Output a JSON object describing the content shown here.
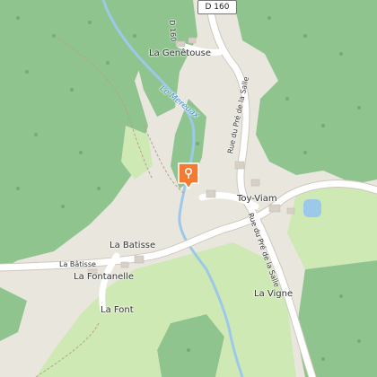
{
  "map": {
    "route_shield": "D 160",
    "road_labels": {
      "top_vertical": "D 160",
      "rue_upper": "Rue du Pré de la Salle",
      "rue_lower": "Rue du Pré de la Salle",
      "batisse_road": "La Bâtisse"
    },
    "places": {
      "genetouse": "La Genêtouse",
      "toy_viam": "Toy-Viam",
      "batisse": "La Batisse",
      "fontanelle": "La Fontanelle",
      "font": "La Font",
      "vigne": "La Vigne"
    },
    "river": "Le Mereuax",
    "colors": {
      "forest": "#8fc48e",
      "meadow": "#cfe9b5",
      "background": "#e9e6de",
      "road": "#ffffff",
      "water": "#9cc9e9",
      "marker": "#f47a33"
    }
  }
}
